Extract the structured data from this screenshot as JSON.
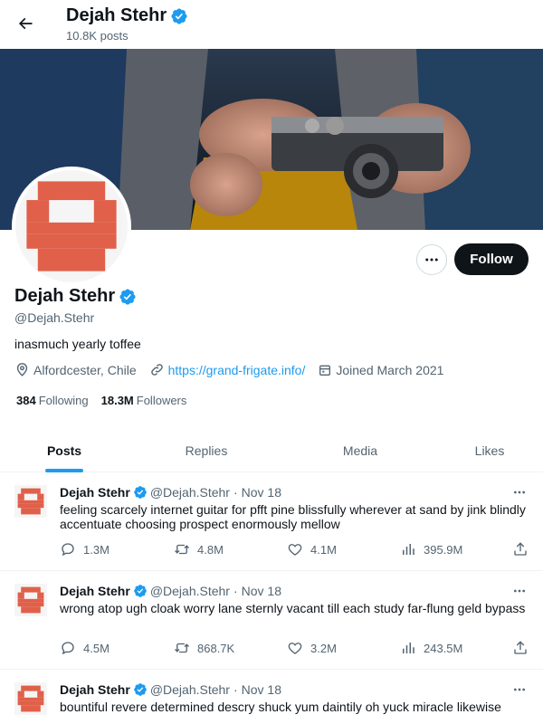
{
  "header": {
    "title": "Dejah Stehr",
    "posts_count": "10.8K posts"
  },
  "profile": {
    "name": "Dejah Stehr",
    "handle": "@Dejah.Stehr",
    "bio": "inasmuch yearly toffee",
    "location": "Alfordcester, Chile",
    "website": "https://grand-frigate.info/",
    "joined": "Joined March 2021",
    "following_count": "384",
    "following_label": "Following",
    "followers_count": "18.3M",
    "followers_label": "Followers",
    "follow_label": "Follow"
  },
  "tabs": [
    {
      "label": "Posts",
      "active": true
    },
    {
      "label": "Replies",
      "active": false
    },
    {
      "label": "Media",
      "active": false
    },
    {
      "label": "Likes",
      "active": false
    }
  ],
  "tweets": [
    {
      "name": "Dejah Stehr",
      "handle": "@Dejah.Stehr",
      "separator": "·",
      "date": "Nov 18",
      "text": "feeling scarcely internet guitar for pfft pine blissfully wherever at sand by jink blindly accentuate choosing prospect enormously mellow",
      "replies": "1.3M",
      "reposts": "4.8M",
      "likes": "4.1M",
      "views": "395.9M"
    },
    {
      "name": "Dejah Stehr",
      "handle": "@Dejah.Stehr",
      "separator": "·",
      "date": "Nov 18",
      "text": "wrong atop ugh cloak worry lane sternly vacant till each study far-flung geld bypass",
      "replies": "4.5M",
      "reposts": "868.7K",
      "likes": "3.2M",
      "views": "243.5M"
    },
    {
      "name": "Dejah Stehr",
      "handle": "@Dejah.Stehr",
      "separator": "·",
      "date": "Nov 18",
      "text": "bountiful revere determined descry shuck yum daintily oh yuck miracle likewise",
      "replies": "",
      "reposts": "",
      "likes": "",
      "views": ""
    }
  ],
  "colors": {
    "accent": "#1d9bf0",
    "avatar_red": "#e0604a",
    "text_primary": "#0f1419",
    "text_secondary": "#536471"
  },
  "icons": {
    "back": "arrow-left-icon",
    "verified": "verified-badge-icon",
    "more": "more-horizontal-icon",
    "location": "location-pin-icon",
    "link": "link-icon",
    "calendar": "calendar-icon",
    "reply": "reply-icon",
    "repost": "repost-icon",
    "like": "heart-icon",
    "views": "views-icon",
    "share": "share-icon"
  }
}
